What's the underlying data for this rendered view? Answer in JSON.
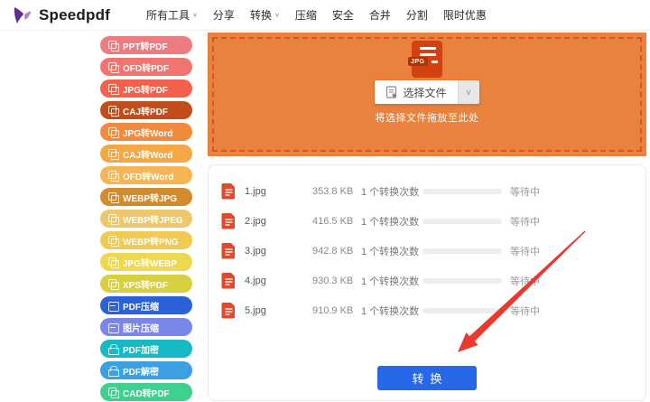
{
  "header": {
    "logo_text": "Speedpdf",
    "nav": [
      {
        "label": "所有工具",
        "dropdown": true
      },
      {
        "label": "分享",
        "dropdown": false
      },
      {
        "label": "转换",
        "dropdown": true
      },
      {
        "label": "压缩",
        "dropdown": false
      },
      {
        "label": "安全",
        "dropdown": false
      },
      {
        "label": "合并",
        "dropdown": false
      },
      {
        "label": "分割",
        "dropdown": false
      },
      {
        "label": "限时优惠",
        "dropdown": false
      }
    ]
  },
  "sidebar": {
    "items": [
      {
        "label": "PPT转PDF",
        "color": "#ec7c80"
      },
      {
        "label": "OFD转PDF",
        "color": "#f2746f"
      },
      {
        "label": "JPG转PDF",
        "color": "#f3604c"
      },
      {
        "label": "CAJ转PDF",
        "color": "#c04d1a"
      },
      {
        "label": "JPG转Word",
        "color": "#f28a3e"
      },
      {
        "label": "CAJ转Word",
        "color": "#f4a742"
      },
      {
        "label": "OFD转Word",
        "color": "#f6b455"
      },
      {
        "label": "WEBP转JPG",
        "color": "#d28b2d"
      },
      {
        "label": "WEBP转JPEG",
        "color": "#eec76a"
      },
      {
        "label": "WEBP转PNG",
        "color": "#f0ca52"
      },
      {
        "label": "JPG转WEBP",
        "color": "#eed84f"
      },
      {
        "label": "XPS转PDF",
        "color": "#d9d041"
      },
      {
        "label": "PDF压缩",
        "color": "#2a62d9"
      },
      {
        "label": "图片压缩",
        "color": "#7b87e8"
      },
      {
        "label": "PDF加密",
        "color": "#17b9c5"
      },
      {
        "label": "PDF解密",
        "color": "#3b9fe2"
      },
      {
        "label": "CAD转PDF",
        "color": "#3ed08e"
      }
    ]
  },
  "dropzone": {
    "background": "#e8823e",
    "file_badge": "JPG",
    "select_button_label": "选择文件",
    "hint": "将选择文件拖放至此处"
  },
  "file_list": {
    "rows": [
      {
        "name": "1.jpg",
        "size": "353.8 KB",
        "count": "1 个转换次数",
        "status": "等待中",
        "progress": 0
      },
      {
        "name": "2.jpg",
        "size": "416.5 KB",
        "count": "1 个转换次数",
        "status": "等待中",
        "progress": 0
      },
      {
        "name": "3.jpg",
        "size": "942.8 KB",
        "count": "1 个转换次数",
        "status": "等待中",
        "progress": 0
      },
      {
        "name": "4.jpg",
        "size": "930.3 KB",
        "count": "1 个转换次数",
        "status": "等待中",
        "progress": 0
      },
      {
        "name": "5.jpg",
        "size": "910.9 KB",
        "count": "1 个转换次数",
        "status": "等待中",
        "progress": 0
      }
    ],
    "convert_button_label": "转换",
    "convert_button_color": "#2768e8"
  },
  "annotations": {
    "arrow_color": "#e83a2e"
  }
}
